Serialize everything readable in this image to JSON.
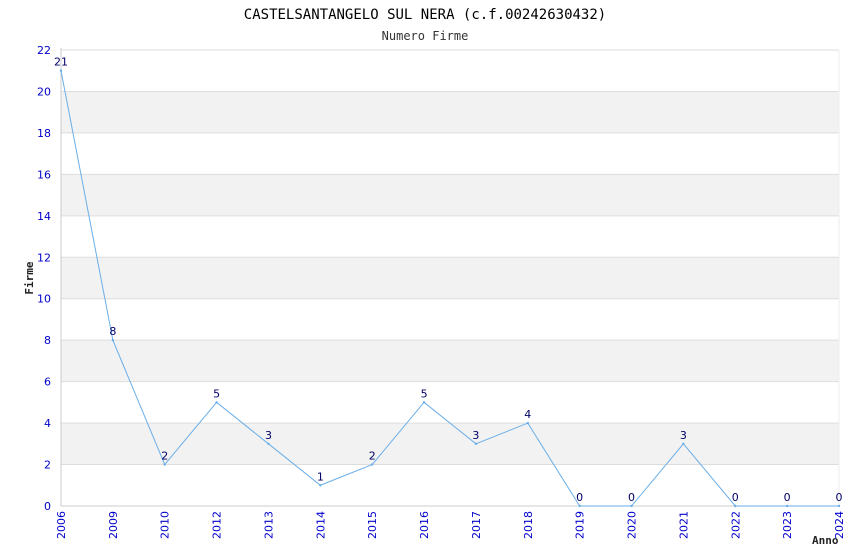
{
  "chart_data": {
    "type": "line",
    "title": "CASTELSANTANGELO SUL NERA (c.f.00242630432)",
    "subtitle": "Numero Firme",
    "xlabel": "Anno",
    "ylabel": "Firme",
    "ylim": [
      0,
      22
    ],
    "yticks": [
      "0",
      "2",
      "4",
      "6",
      "8",
      "10",
      "12",
      "14",
      "16",
      "18",
      "20",
      "22"
    ],
    "categories": [
      "2006",
      "2009",
      "2010",
      "2012",
      "2013",
      "2014",
      "2015",
      "2016",
      "2017",
      "2018",
      "2019",
      "2020",
      "2021",
      "2022",
      "2023",
      "2024"
    ],
    "values": [
      21,
      8,
      2,
      5,
      3,
      1,
      2,
      5,
      3,
      4,
      0,
      0,
      3,
      0,
      0,
      0
    ],
    "grid": true,
    "legend": "none",
    "colors": {
      "line": "#6aaee8",
      "band": "#f2f2f2",
      "grid": "#dddddd",
      "tick": "#0000cc"
    }
  }
}
